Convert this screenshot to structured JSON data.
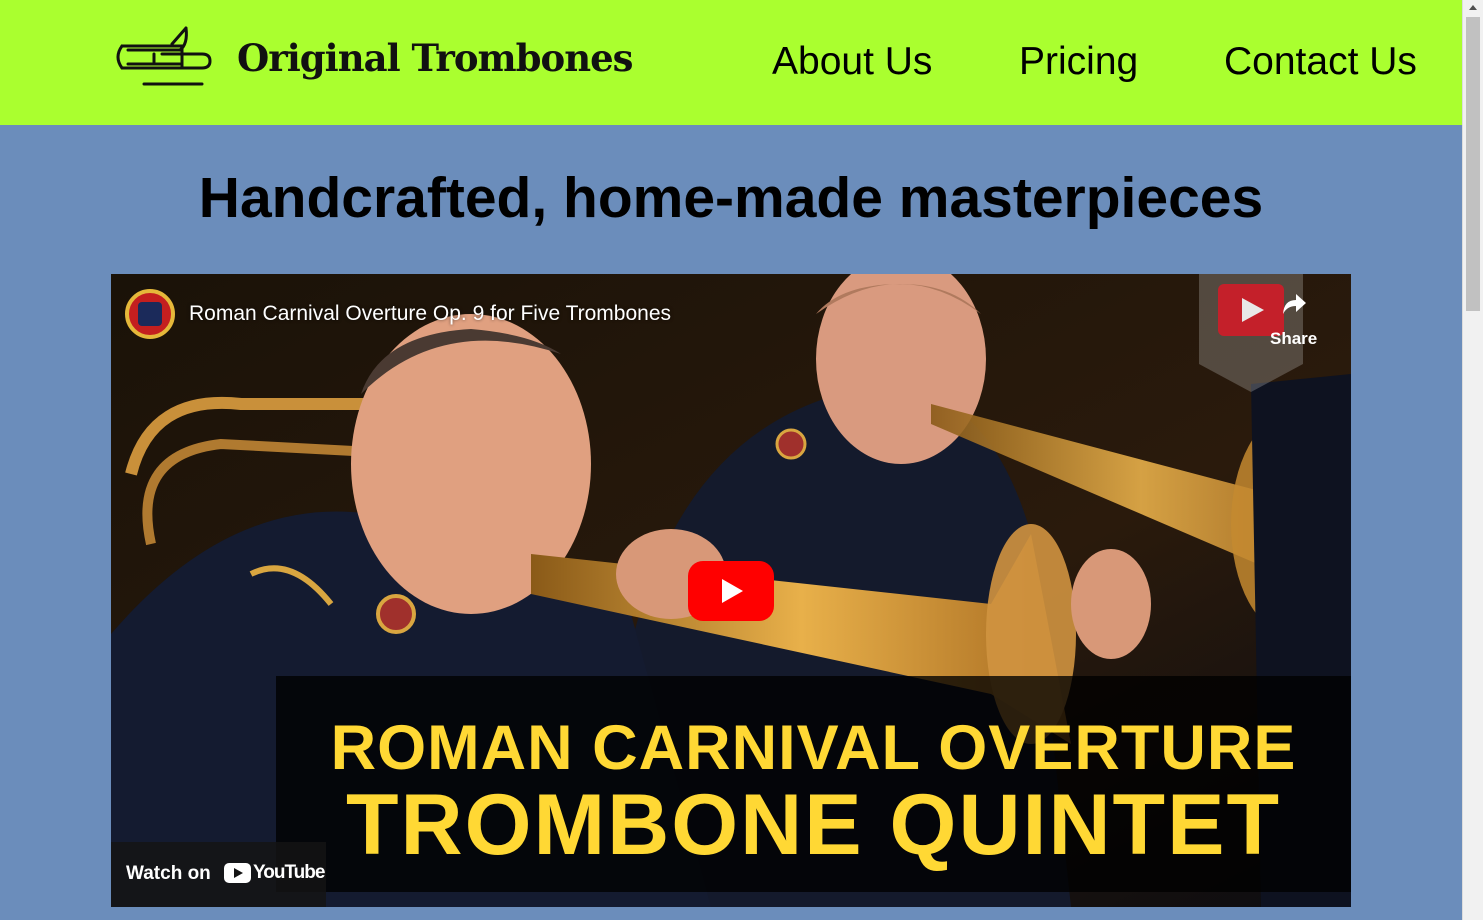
{
  "header": {
    "brand": "Original Trombones",
    "nav": [
      {
        "label": "About Us"
      },
      {
        "label": "Pricing"
      },
      {
        "label": "Contact Us"
      }
    ]
  },
  "colors": {
    "header_bg": "#aaff2f",
    "page_bg": "#6b8dbb",
    "overlay_text": "#ffd834",
    "play_button": "#ff0000"
  },
  "hero": {
    "headline": "Handcrafted, home-made masterpieces"
  },
  "video": {
    "title": "Roman Carnival Overture Op. 9 for Five Trombones",
    "share_label": "Share",
    "overlay_line1": "ROMAN CARNIVAL OVERTURE",
    "overlay_line2": "TROMBONE QUINTET",
    "watch_on": "Watch on",
    "youtube_logo": "YouTube",
    "icons": [
      "play-icon",
      "share-icon",
      "youtube-icon",
      "channel-avatar"
    ]
  }
}
